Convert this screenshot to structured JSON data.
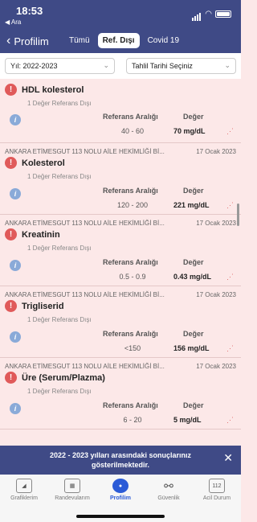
{
  "status": {
    "time": "18:53",
    "back_app": "◀ Ara"
  },
  "header": {
    "back_label": "Profilim",
    "tabs": [
      {
        "label": "Tümü"
      },
      {
        "label": "Ref. Dışı"
      },
      {
        "label": "Covid 19"
      }
    ]
  },
  "filters": {
    "year": "Yıl: 2022-2023",
    "date": "Tahlil Tarihi Seçiniz"
  },
  "columns": {
    "ref": "Referans Aralığı",
    "val": "Değer"
  },
  "results": [
    {
      "source": "",
      "date": "",
      "name": "HDL kolesterol",
      "count": "1 Değer Referans Dışı",
      "ref": "40 - 60",
      "value": "70 mg/dL"
    },
    {
      "source": "ANKARA ETİMESGUT 113 NOLU AİLE HEKİMLİĞİ Bİ...",
      "date": "17 Ocak 2023",
      "name": "Kolesterol",
      "count": "1 Değer Referans Dışı",
      "ref": "120 - 200",
      "value": "221 mg/dL"
    },
    {
      "source": "ANKARA ETİMESGUT 113 NOLU AİLE HEKİMLİĞİ Bİ...",
      "date": "17 Ocak 2023",
      "name": "Kreatinin",
      "count": "1 Değer Referans Dışı",
      "ref": "0.5 - 0.9",
      "value": "0.43 mg/dL"
    },
    {
      "source": "ANKARA ETİMESGUT 113 NOLU AİLE HEKİMLİĞİ Bİ...",
      "date": "17 Ocak 2023",
      "name": "Trigliserid",
      "count": "1 Değer Referans Dışı",
      "ref": "<150",
      "value": "156 mg/dL"
    },
    {
      "source": "ANKARA ETİMESGUT 113 NOLU AİLE HEKİMLİĞİ Bİ...",
      "date": "17 Ocak 2023",
      "name": "Üre (Serum/Plazma)",
      "count": "1 Değer Referans Dışı",
      "ref": "6 - 20",
      "value": "5 mg/dL"
    }
  ],
  "banner": {
    "text": "2022 - 2023 yılları arasındaki sonuçlarınız gösterilmektedir."
  },
  "tabbar": [
    {
      "label": "Grafiklerim",
      "icon": "chart-icon"
    },
    {
      "label": "Randevularım",
      "icon": "calendar-icon"
    },
    {
      "label": "Profilim",
      "icon": "person-icon"
    },
    {
      "label": "Güvenlik",
      "icon": "link-icon"
    },
    {
      "label": "Acil Durum",
      "icon": "emergency-icon",
      "badge": "112"
    }
  ],
  "colors": {
    "header": "#3f4a86",
    "card_bg": "#fce8e8",
    "warning": "#e05a5a",
    "active_tab": "#2b5bd7"
  }
}
